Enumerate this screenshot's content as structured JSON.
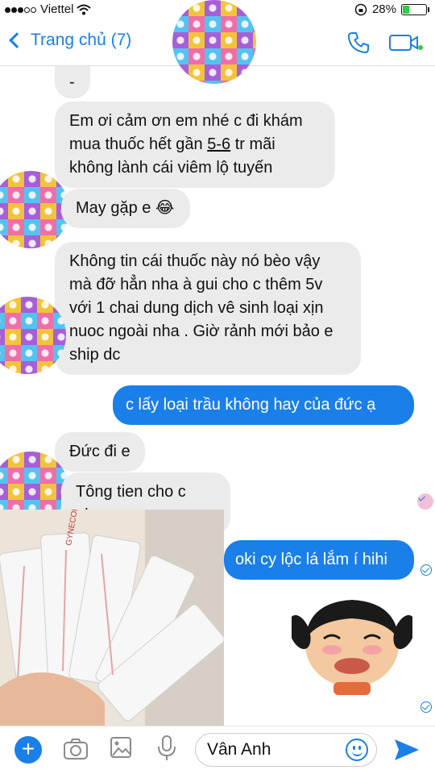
{
  "status_bar": {
    "carrier": "Viettel",
    "battery_percent": "28%"
  },
  "header": {
    "back_label": "Trang chủ (7)",
    "colors": {
      "accent": "#1a7fe8"
    }
  },
  "messages": [
    {
      "from": "them",
      "text": "-"
    },
    {
      "from": "them",
      "text_before": "Em ơi cảm ơn em nhé c đi khám mua thuốc hết gần ",
      "text_underlined": "5-6",
      "text_after": " tr mãi không lành cái viêm lộ tuyến"
    },
    {
      "from": "them",
      "text": "May gặp e 😂"
    },
    {
      "from": "them",
      "text": "Không tin cái thuốc này nó bèo vậy mà đỡ hẳn nha à gui cho c thêm 5v với 1 chai dung dịch vê sinh loại xịn nuoc ngoài nha . Giờ rảnh mới bảo e ship dc"
    },
    {
      "from": "me",
      "text": "c lấy loại trầu không hay của đức ạ"
    },
    {
      "from": "them",
      "text": "Đức đi e"
    },
    {
      "from": "them",
      "text": "Tông tien cho c nha"
    },
    {
      "from": "me",
      "text": "oki cy lộc lá lắm í hihi"
    }
  ],
  "photo": {
    "label": "GYNECON"
  },
  "composer": {
    "value": "Vân Anh"
  }
}
